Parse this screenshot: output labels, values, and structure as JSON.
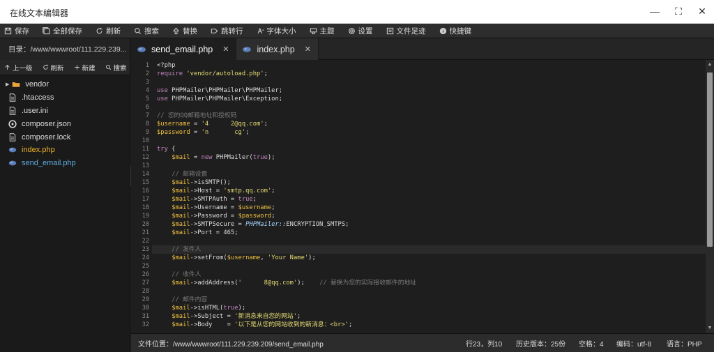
{
  "title": "在线文本编辑器",
  "window_controls": [
    "—",
    "⛶",
    "✕"
  ],
  "toolbar": [
    {
      "label": "保存",
      "icon": "save-icon"
    },
    {
      "label": "全部保存",
      "icon": "save-all-icon"
    },
    {
      "label": "刷新",
      "icon": "refresh-icon"
    },
    {
      "label": "搜索",
      "icon": "search-icon"
    },
    {
      "label": "替换",
      "icon": "replace-icon"
    },
    {
      "label": "跳转行",
      "icon": "goto-line-icon"
    },
    {
      "label": "字体大小",
      "icon": "font-size-icon"
    },
    {
      "label": "主题",
      "icon": "theme-icon"
    },
    {
      "label": "设置",
      "icon": "gear-icon"
    },
    {
      "label": "文件足迹",
      "icon": "history-icon"
    },
    {
      "label": "快捷键",
      "icon": "info-icon"
    }
  ],
  "sidebar": {
    "directory": "目录：/www/wwwroot/111.229.239...",
    "actions": [
      {
        "label": "上一级",
        "icon": "arrow-up-icon"
      },
      {
        "label": "刷新",
        "icon": "refresh-icon"
      },
      {
        "label": "新建",
        "icon": "plus-icon"
      },
      {
        "label": "搜索",
        "icon": "search-icon"
      }
    ],
    "files": [
      {
        "name": "vendor",
        "type": "folder"
      },
      {
        "name": ".htaccess",
        "type": "file"
      },
      {
        "name": ".user.ini",
        "type": "file"
      },
      {
        "name": "composer.json",
        "type": "json"
      },
      {
        "name": "composer.lock",
        "type": "file"
      },
      {
        "name": "index.php",
        "type": "php"
      },
      {
        "name": "send_email.php",
        "type": "php-current"
      }
    ]
  },
  "tabs": [
    {
      "label": "send_email.php",
      "active": true
    },
    {
      "label": "index.php",
      "active": false
    }
  ],
  "editor": {
    "lines": [
      "<?php",
      "require 'vendor/autoload.php';",
      "",
      "use PHPMailer\\PHPMailer\\PHPMailer;",
      "use PHPMailer\\PHPMailer\\Exception;",
      "",
      "// 您的QQ邮箱地址和授权码",
      "$username = '4      2@qq.com';",
      "$password = 'n       cg';",
      "",
      "try {",
      "    $mail = new PHPMailer(true);",
      "",
      "    // 邮箱设置",
      "    $mail->isSMTP();",
      "    $mail->Host = 'smtp.qq.com';",
      "    $mail->SMTPAuth = true;",
      "    $mail->Username = $username;",
      "    $mail->Password = $password;",
      "    $mail->SMTPSecure = PHPMailer::ENCRYPTION_SMTPS;",
      "    $mail->Port = 465;",
      "",
      "    // 发件人",
      "    $mail->setFrom($username, 'Your Name');",
      "",
      "    // 收件人",
      "    $mail->addAddress('      8@qq.com');    // 替换为您的实际接收邮件的地址",
      "",
      "    // 邮件内容",
      "    $mail->isHTML(true);",
      "    $mail->Subject = '新消息来自您的网站';",
      "    $mail->Body    = '以下是从您的网站收到的新消息：<br>';"
    ],
    "current_line": 23
  },
  "status": {
    "path": "文件位置：/www/wwwroot/111.229.239.209/send_email.php",
    "position": "行23，列10",
    "history": "历史版本：25份",
    "indent": "空格：4",
    "encoding": "编码：utf-8",
    "language": "语言：PHP"
  },
  "colors": {
    "background": "#1e1e1e",
    "php_file": "#f0b429",
    "current_file": "#5dade2",
    "keyword": "#c586c0",
    "string": "#e6db74"
  }
}
